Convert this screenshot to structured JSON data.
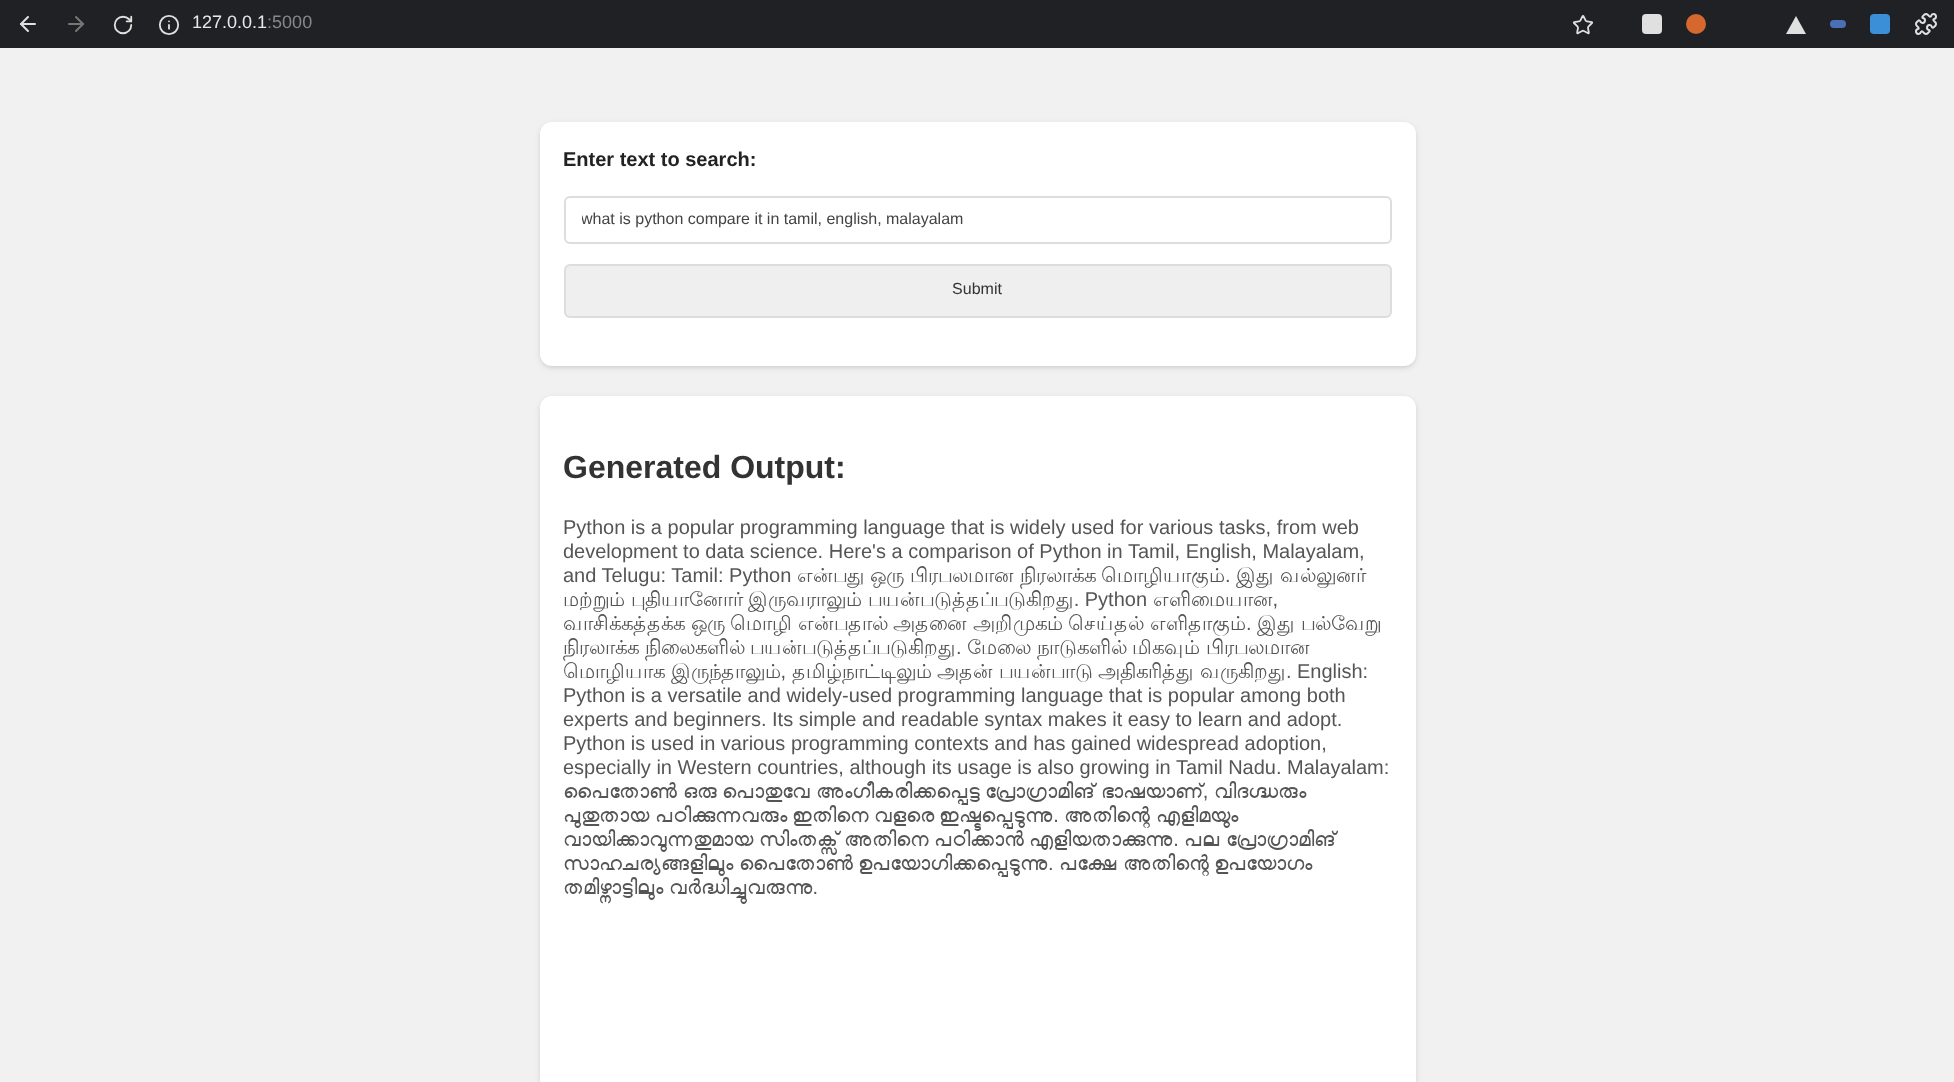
{
  "browser": {
    "url_host": "127.0.0.1",
    "url_port": ":5000"
  },
  "search": {
    "label": "Enter text to search:",
    "value": "what is python compare it in tamil, english, malayalam",
    "button": "Submit"
  },
  "output": {
    "title": "Generated Output:",
    "text": "Python is a popular programming language that is widely used for various tasks, from web development to data science. Here's a comparison of Python in Tamil, English, Malayalam, and Telugu: Tamil: Python என்பது ஒரு பிரபலமான நிரலாக்க மொழியாகும். இது வல்லுனர் மற்றும் புதியானோர் இருவராலும் பயன்படுத்தப்படுகிறது. Python எளிமையான, வாசிக்கத்தக்க ஒரு மொழி என்பதால் அதனை அறிமுகம் செய்தல் எளிதாகும். இது பல்வேறு நிரலாக்க நிலைகளில் பயன்படுத்தப்படுகிறது. மேலை நாடுகளில் மிகவும் பிரபலமான மொழியாக இருந்தாலும், தமிழ்நாட்டிலும் அதன் பயன்பாடு அதிகரித்து வருகிறது. English: Python is a versatile and widely-used programming language that is popular among both experts and beginners. Its simple and readable syntax makes it easy to learn and adopt. Python is used in various programming contexts and has gained widespread adoption, especially in Western countries, although its usage is also growing in Tamil Nadu. Malayalam: പൈതോൺ ഒരു പൊതുവേ അംഗീകരിക്കപ്പെട്ട പ്രോഗ്രാമിങ് ഭാഷയാണ്, വിദഗ്ദ്ധരും പുതുതായ പഠിക്കുന്നവരും ഇതിനെ വളരെ ഇഷ്ടപ്പെടുന്നു. അതിന്റെ എളിമയും വായിക്കാവുന്നതുമായ സിംതക്സ് അതിനെ പഠിക്കാൻ എളിയതാക്കുന്നു. പല പ്രോഗ്രാമിങ് സാഹചര്യങ്ങളിലും പൈതോൺ ഉപയോഗിക്കപ്പെടുന്നു. പക്ഷേ അതിന്റെ ഉപയോഗം തമിഴ്നാട്ടിലും വർദ്ധിച്ചുവരുന്നു."
  }
}
